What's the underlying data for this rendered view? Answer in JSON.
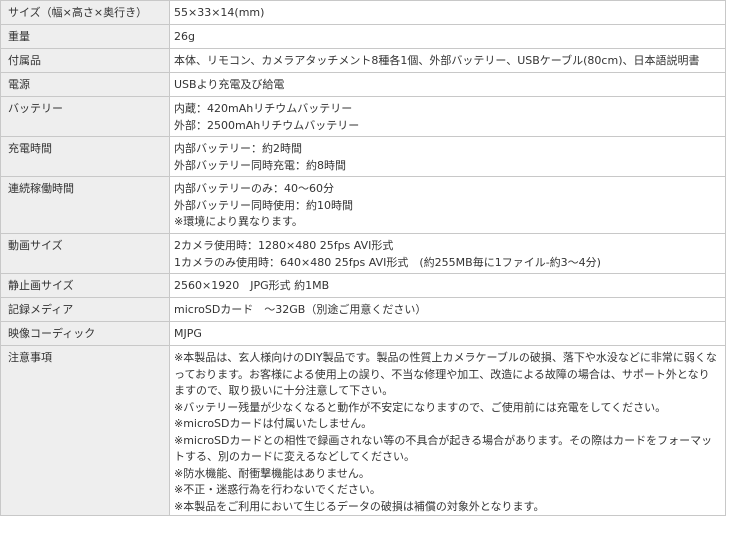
{
  "spec_table": {
    "rows": [
      {
        "label": "サイズ（幅×高さ×奥行き）",
        "lines": [
          "55×33×14(mm)"
        ]
      },
      {
        "label": "重量",
        "lines": [
          "26g"
        ]
      },
      {
        "label": "付属品",
        "lines": [
          "本体、リモコン、カメラアタッチメント8種各1個、外部バッテリー、USBケーブル(80cm)、日本語説明書"
        ]
      },
      {
        "label": "電源",
        "lines": [
          "USBより充電及び給電"
        ]
      },
      {
        "label": "バッテリー",
        "lines": [
          "内蔵：420mAhリチウムバッテリー",
          "外部：2500mAhリチウムバッテリー"
        ]
      },
      {
        "label": "充電時間",
        "lines": [
          "内部バッテリー：約2時間",
          "外部バッテリー同時充電：約8時間"
        ]
      },
      {
        "label": "連続稼働時間",
        "lines": [
          "内部バッテリーのみ：40～60分",
          "外部バッテリー同時使用：約10時間",
          "※環境により異なります。"
        ]
      },
      {
        "label": "動画サイズ",
        "lines": [
          "2カメラ使用時：1280×480 25fps AVI形式",
          "1カメラのみ使用時：640×480 25fps AVI形式　(約255MB毎に1ファイル-約3～4分)"
        ]
      },
      {
        "label": "静止画サイズ",
        "lines": [
          "2560×1920　JPG形式 約1MB"
        ]
      },
      {
        "label": "記録メディア",
        "lines": [
          "microSDカード　～32GB（別途ご用意ください）"
        ]
      },
      {
        "label": "映像コーディック",
        "lines": [
          "MJPG"
        ]
      },
      {
        "label": "注意事項",
        "lines": [
          "※本製品は、玄人様向けのDIY製品です。製品の性質上カメラケーブルの破損、落下や水没などに非常に弱くなっております。お客様による使用上の誤り、不当な修理や加工、改造による故障の場合は、サポート外となりますので、取り扱いに十分注意して下さい。",
          "※バッテリー残量が少なくなると動作が不安定になりますので、ご使用前には充電をしてください。",
          "※microSDカードは付属いたしません。",
          "※microSDカードとの相性で録画されない等の不具合が起きる場合があります。その際はカードをフォーマットする、別のカードに変えるなどしてください。",
          "※防水機能、耐衝撃機能はありません。",
          "※不正・迷惑行為を行わないでください。",
          "※本製品をご利用において生じるデータの破損は補償の対象外となります。"
        ]
      }
    ]
  }
}
